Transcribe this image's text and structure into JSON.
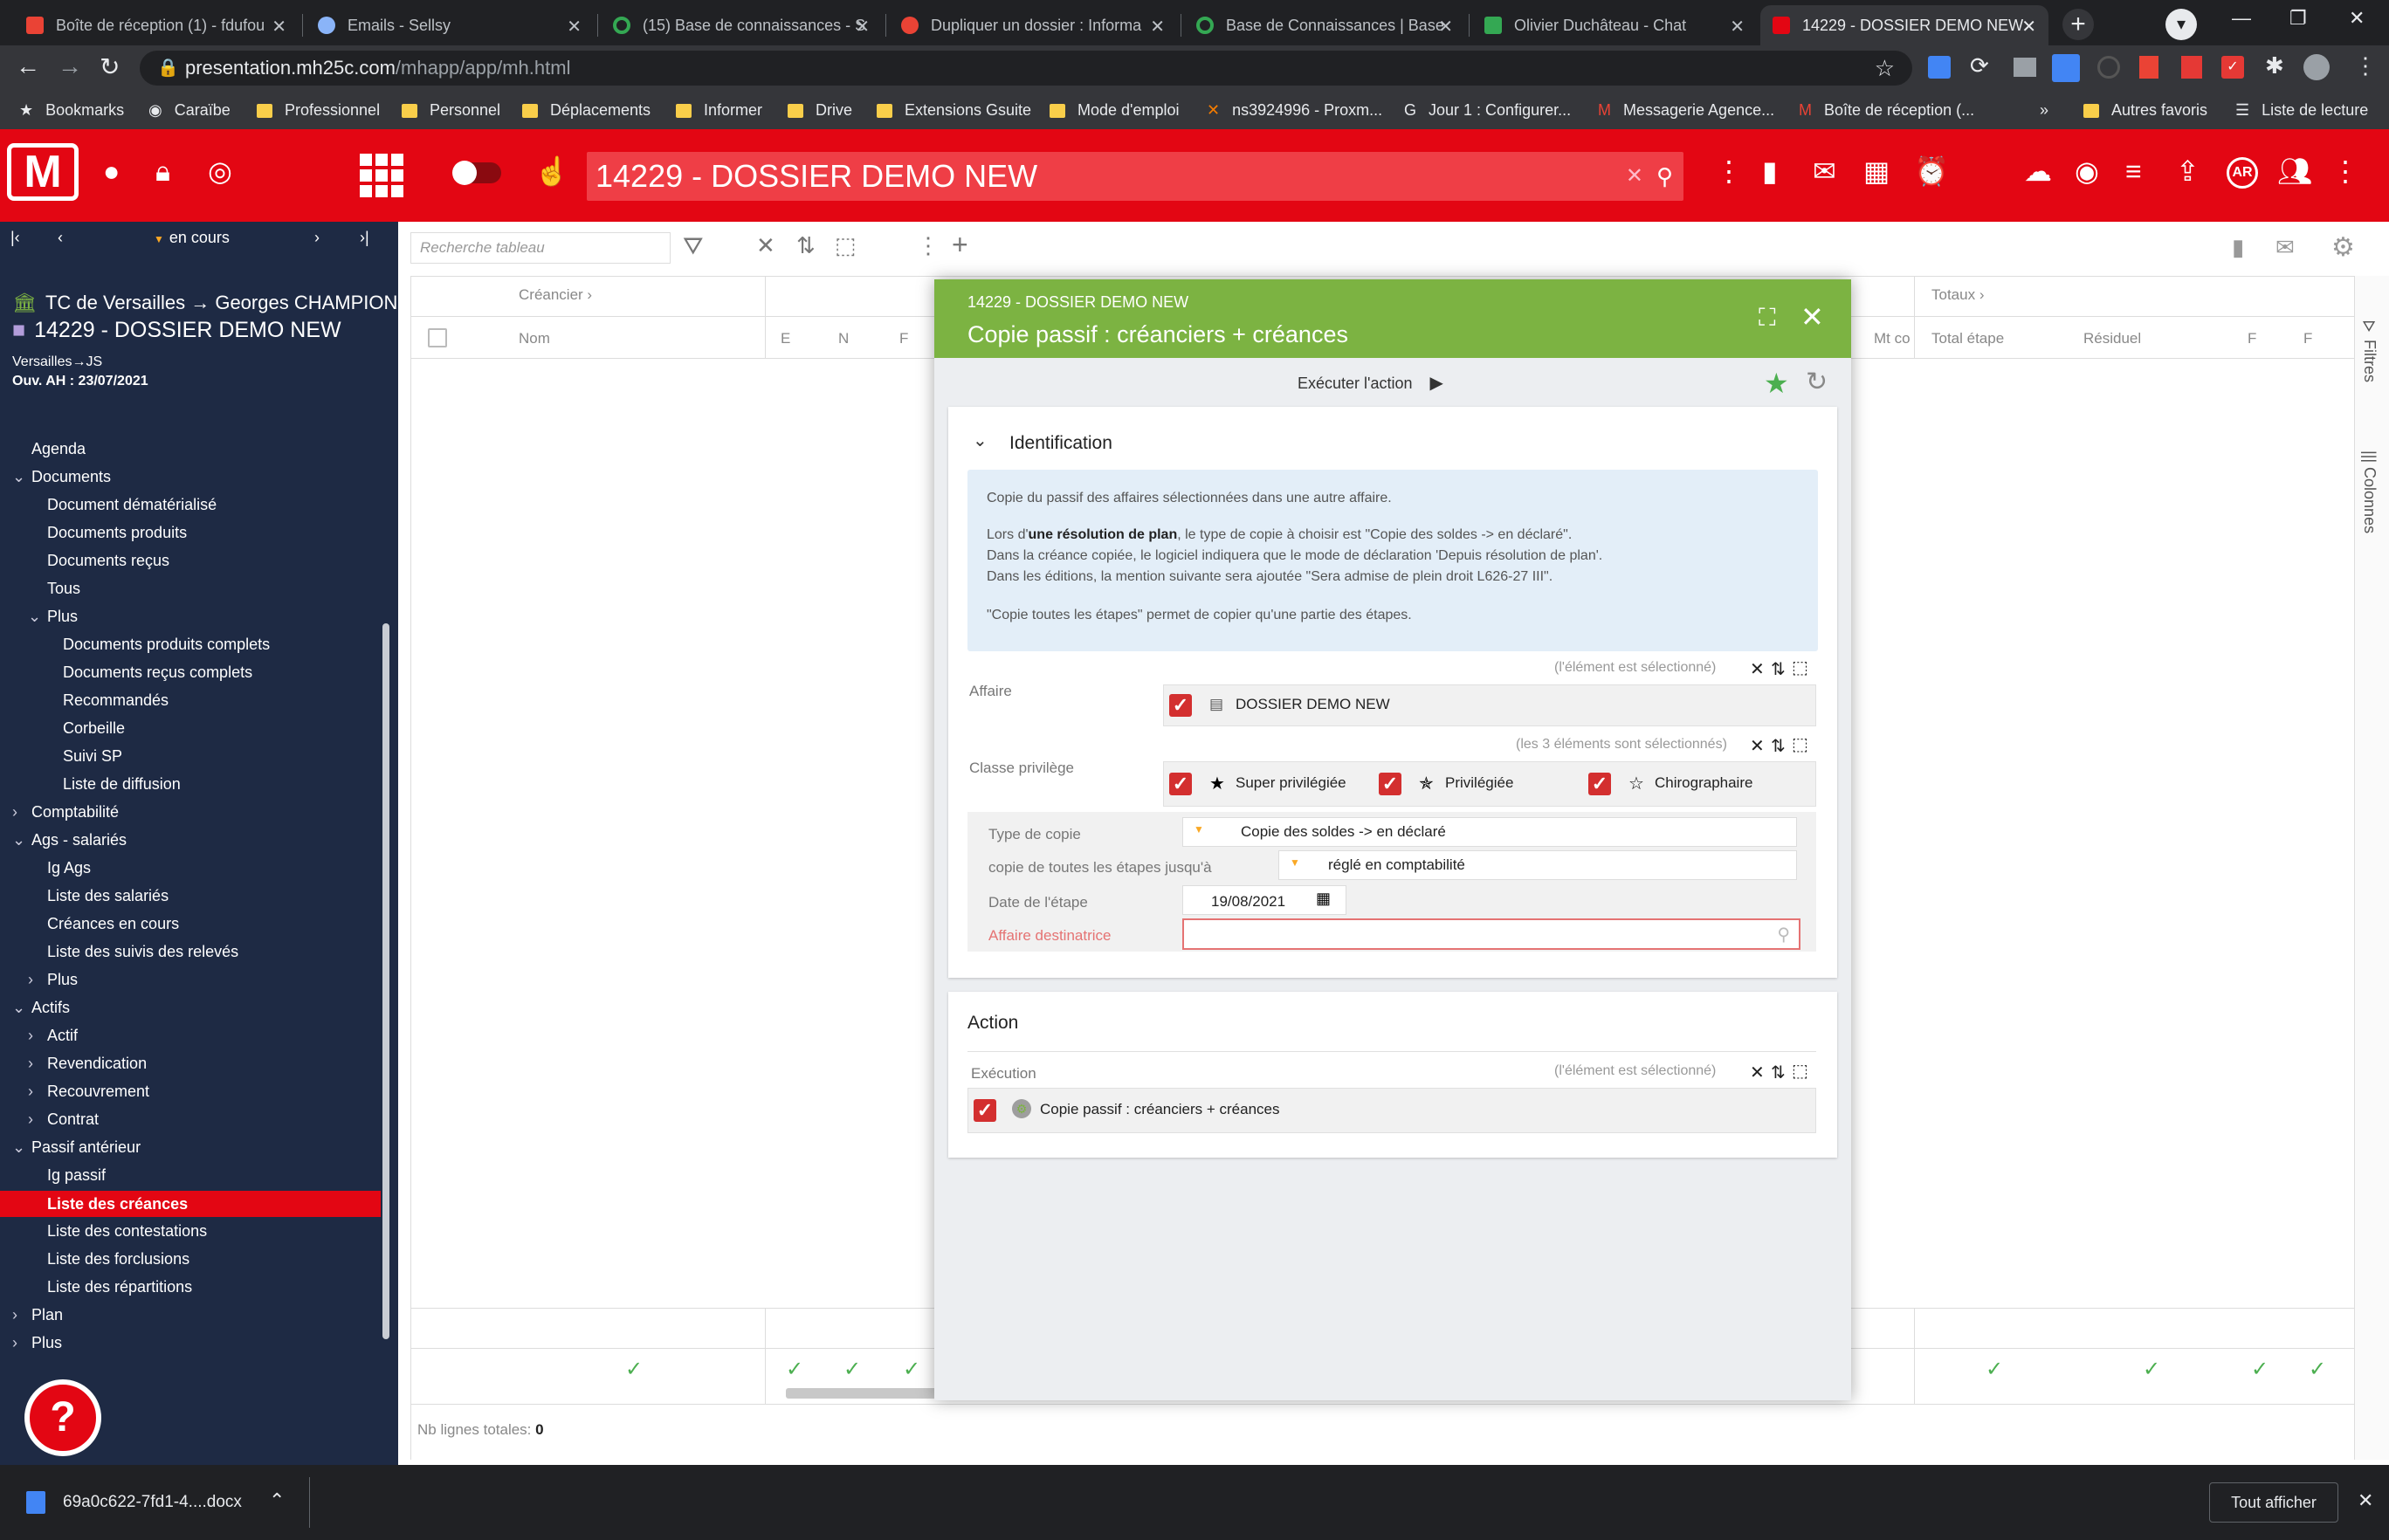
{
  "browser": {
    "tabs": [
      {
        "label": "Boîte de réception (1) - fdufou",
        "icon": "gmail-icon",
        "color": "#ea4335"
      },
      {
        "label": "Emails - Sellsy",
        "icon": "cloud-icon",
        "color": "#8ab4f8"
      },
      {
        "label": "(15) Base de connaissances - S",
        "icon": "circle-icon",
        "color": "#34a853"
      },
      {
        "label": "Dupliquer un dossier : Informa",
        "icon": "doc-icon",
        "color": "#ea4335"
      },
      {
        "label": "Base de Connaissances | Base",
        "icon": "circle-icon",
        "color": "#34a853"
      },
      {
        "label": "Olivier Duchâteau - Chat",
        "icon": "chat-icon",
        "color": "#34a853"
      },
      {
        "label": "14229 - DOSSIER DEMO NEW",
        "icon": "mh-icon",
        "color": "#e30613"
      }
    ],
    "url_host": "presentation.mh25c.com",
    "url_path": "/mhapp/app/mh.html",
    "bookmarks": [
      "Bookmarks",
      "Caraïbe",
      "Professionnel",
      "Personnel",
      "Déplacements",
      "Informer",
      "Drive",
      "Extensions Gsuite",
      "Mode d'emploi",
      "ns3924996 - Proxm...",
      "Jour 1 : Configurer...",
      "Messagerie Agence...",
      "Boîte de réception (...",
      "»",
      "Autres favoris",
      "Liste de lecture"
    ]
  },
  "app": {
    "title": "14229 - DOSSIER DEMO NEW",
    "brand_color": "#e30613"
  },
  "sidebar": {
    "filter_label": "en cours",
    "court": "TC de Versailles → Georges CHAMPION",
    "dossier": "14229 - DOSSIER DEMO NEW",
    "meta1": "Versailles→JS",
    "meta2": "Ouv. AH : 23/07/2021",
    "items": [
      {
        "label": "Agenda",
        "level": 0,
        "chev": ""
      },
      {
        "label": "Documents",
        "level": 0,
        "chev": "v"
      },
      {
        "label": "Document dématérialisé",
        "level": 1,
        "chev": ""
      },
      {
        "label": "Documents produits",
        "level": 1,
        "chev": ""
      },
      {
        "label": "Documents reçus",
        "level": 1,
        "chev": ""
      },
      {
        "label": "Tous",
        "level": 1,
        "chev": ""
      },
      {
        "label": "Plus",
        "level": 1,
        "chev": "v"
      },
      {
        "label": "Documents produits complets",
        "level": 2,
        "chev": ""
      },
      {
        "label": "Documents reçus complets",
        "level": 2,
        "chev": ""
      },
      {
        "label": "Recommandés",
        "level": 2,
        "chev": ""
      },
      {
        "label": "Corbeille",
        "level": 2,
        "chev": ""
      },
      {
        "label": "Suivi SP",
        "level": 2,
        "chev": ""
      },
      {
        "label": "Liste de diffusion",
        "level": 2,
        "chev": ""
      },
      {
        "label": "Comptabilité",
        "level": 0,
        "chev": ">"
      },
      {
        "label": "Ags - salariés",
        "level": 0,
        "chev": "v"
      },
      {
        "label": "Ig Ags",
        "level": 1,
        "chev": ""
      },
      {
        "label": "Liste des salariés",
        "level": 1,
        "chev": ""
      },
      {
        "label": "Créances en cours",
        "level": 1,
        "chev": ""
      },
      {
        "label": "Liste des suivis des relevés",
        "level": 1,
        "chev": ""
      },
      {
        "label": "Plus",
        "level": 1,
        "chev": ">"
      },
      {
        "label": "Actifs",
        "level": 0,
        "chev": "v"
      },
      {
        "label": "Actif",
        "level": 1,
        "chev": ">"
      },
      {
        "label": "Revendication",
        "level": 1,
        "chev": ">"
      },
      {
        "label": "Recouvrement",
        "level": 1,
        "chev": ">"
      },
      {
        "label": "Contrat",
        "level": 1,
        "chev": ">"
      },
      {
        "label": "Passif antérieur",
        "level": 0,
        "chev": "v"
      },
      {
        "label": "Ig passif",
        "level": 1,
        "chev": ""
      },
      {
        "label": "Liste des créances",
        "level": 1,
        "chev": "",
        "active": true
      },
      {
        "label": "Liste des contestations",
        "level": 1,
        "chev": ""
      },
      {
        "label": "Liste des forclusions",
        "level": 1,
        "chev": ""
      },
      {
        "label": "Liste des répartitions",
        "level": 1,
        "chev": ""
      },
      {
        "label": "Plan",
        "level": 0,
        "chev": ">"
      },
      {
        "label": "Plus",
        "level": 0,
        "chev": ">"
      }
    ]
  },
  "table": {
    "search_placeholder": "Recherche tableau",
    "group_creancier": "Créancier",
    "group_totaux": "Totaux",
    "col_nom": "Nom",
    "col_e": "E",
    "col_n": "N",
    "col_f": "F",
    "col_mtco": "Mt co",
    "col_total": "Total étape",
    "col_residuel": "Résiduel",
    "col_f2": "F",
    "col_f3": "F",
    "total_rows_label": "Nb lignes totales:",
    "total_rows_value": "0",
    "right_panel_filters": "Filtres",
    "right_panel_columns": "Colonnes"
  },
  "modal": {
    "subtitle": "14229 - DOSSIER DEMO NEW",
    "title": "Copie passif : créanciers + créances",
    "execute_label": "Exécuter l'action",
    "section1_title": "Identification",
    "info_line1": "Copie du passif des affaires sélectionnées dans une autre affaire.",
    "info_line2_pre": "Lors d'",
    "info_line2_bold": "une résolution de plan",
    "info_line2_post": ", le type de copie à choisir est \"Copie des soldes -> en déclaré\".",
    "info_line3": "Dans la créance copiée, le logiciel indiquera que le mode de déclaration 'Depuis résolution de plan'.",
    "info_line4": "Dans les éditions, la mention suivante sera ajoutée \"Sera admise de plein droit L626-27 III\".",
    "info_line5": "\"Copie toutes les étapes\" permet de copier qu'une partie des étapes.",
    "affaire_label": "Affaire",
    "affaire_selected_note": "(l'élément est sélectionné)",
    "affaire_value": "DOSSIER DEMO NEW",
    "classe_label": "Classe privilège",
    "classe_selected_note": "(les 3 éléments sont sélectionnés)",
    "classe_opt1": "Super privilégiée",
    "classe_opt2": "Privilégiée",
    "classe_opt3": "Chirographaire",
    "type_copie_label": "Type de copie",
    "type_copie_value": "Copie des soldes -> en déclaré",
    "etapes_label": "copie de toutes les étapes jusqu'à",
    "etapes_value": "réglé en comptabilité",
    "date_label": "Date de l'étape",
    "date_value": "19/08/2021",
    "dest_label": "Affaire destinatrice",
    "dest_value": "",
    "section2_title": "Action",
    "execution_label": "Exécution",
    "execution_note": "(l'élément est sélectionné)",
    "execution_value": "Copie passif : créanciers + créances"
  },
  "download": {
    "file": "69a0c622-7fd1-4....docx",
    "show_all": "Tout afficher"
  }
}
